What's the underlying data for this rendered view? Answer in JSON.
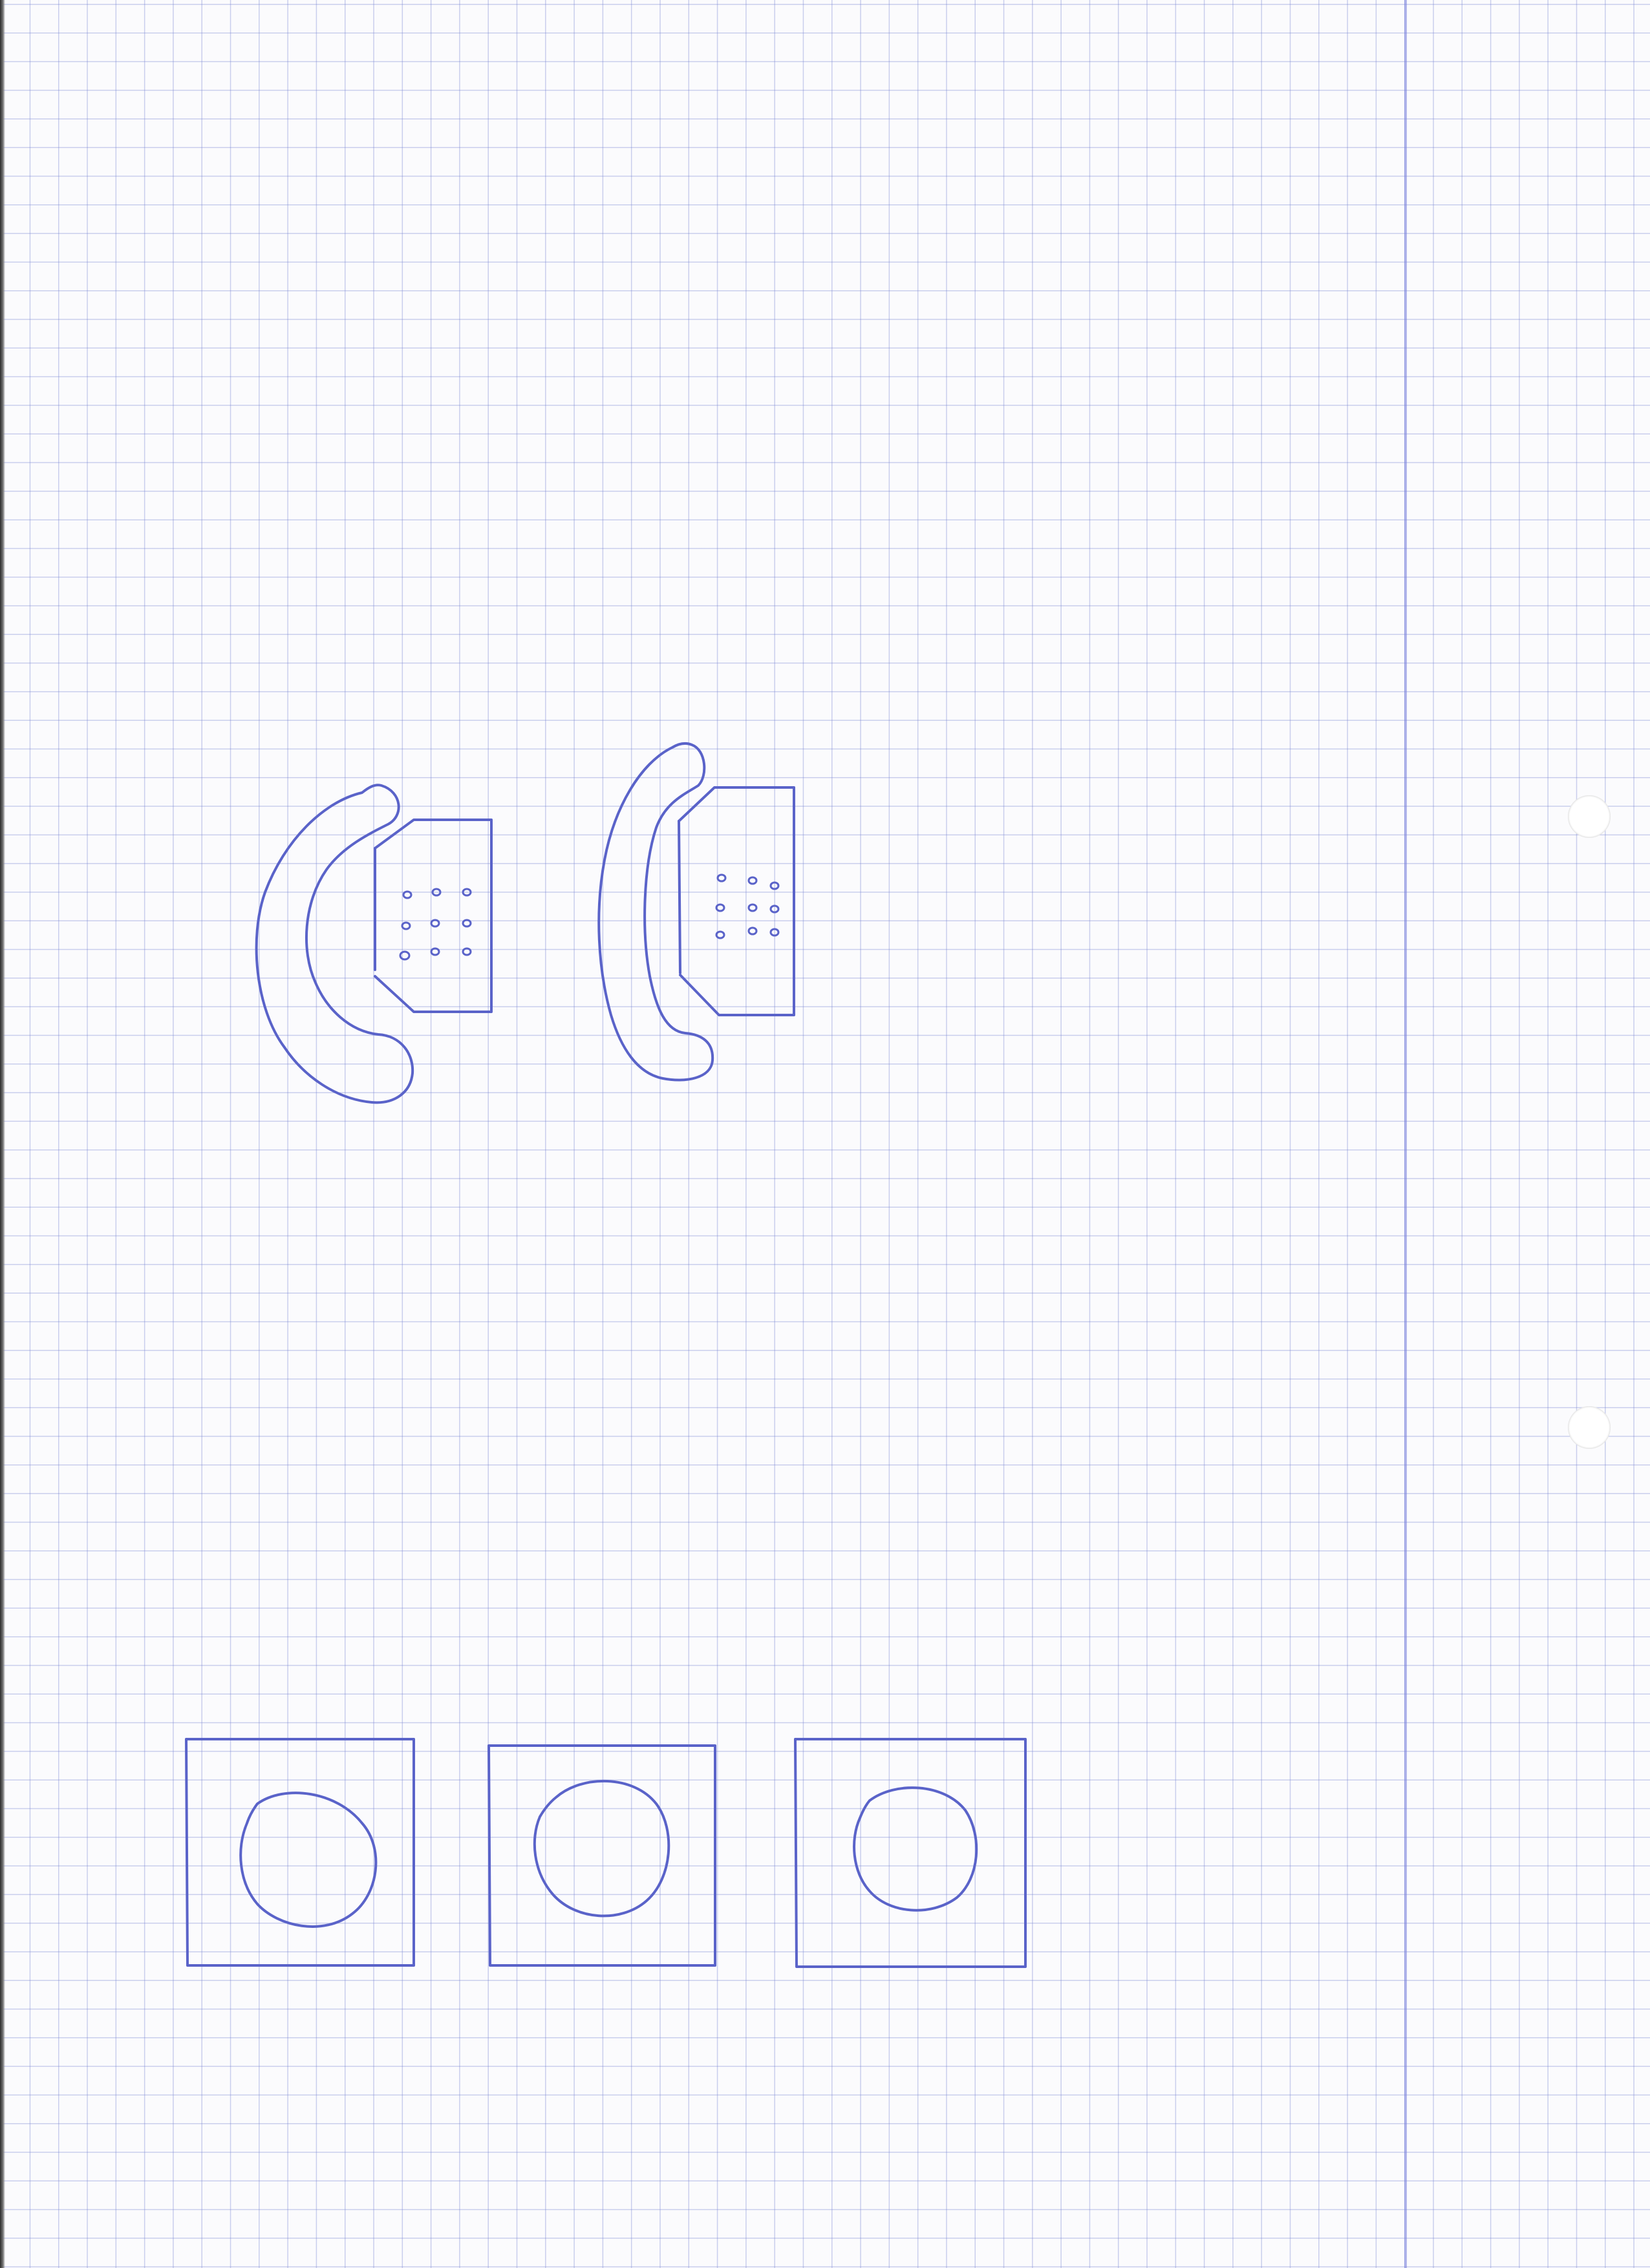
{
  "sheet": {
    "type": "graph-paper",
    "grid_color": "#7884d2",
    "margin_line_color": "#7880dc",
    "ink_color": "#5a63c9",
    "punch_holes": 2
  },
  "sketches": {
    "telephones": [
      {
        "name": "telephone-1",
        "keypad_dots": 9
      },
      {
        "name": "telephone-2",
        "keypad_dots": 9
      }
    ],
    "round_buttons": [
      {
        "name": "round-button-1"
      },
      {
        "name": "round-button-2"
      },
      {
        "name": "round-button-3"
      }
    ]
  }
}
